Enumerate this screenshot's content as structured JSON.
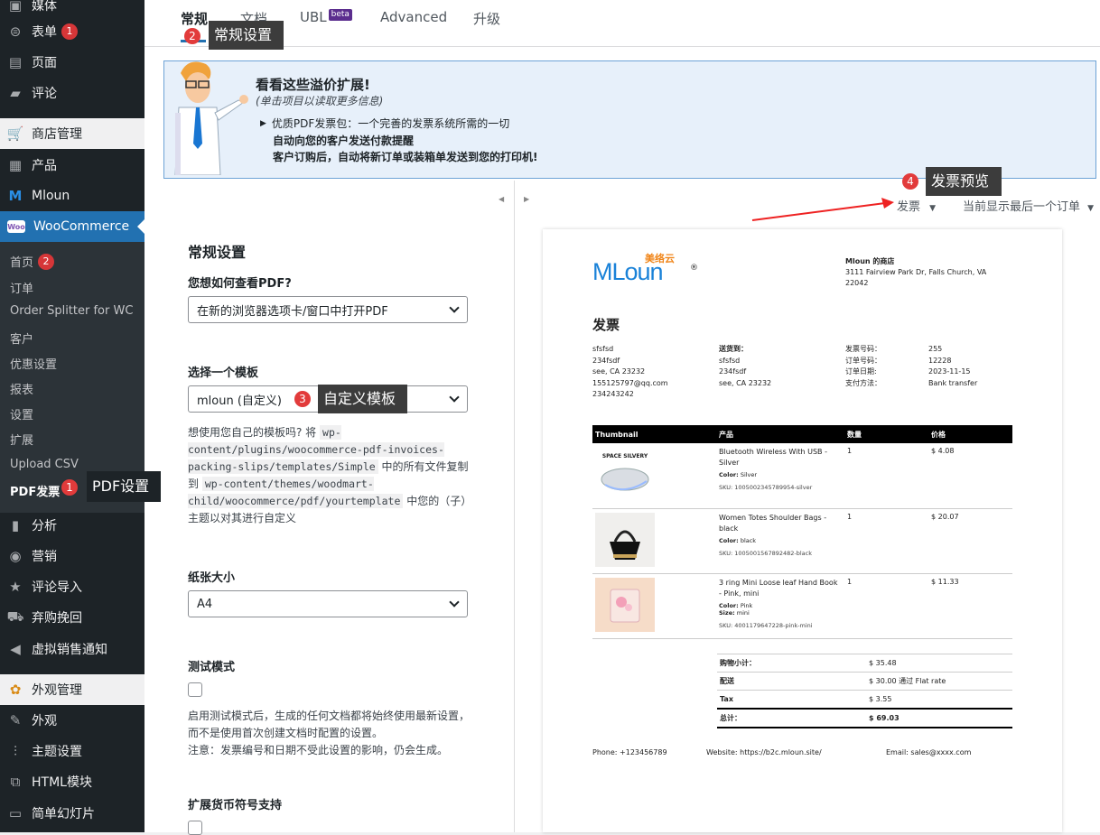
{
  "sidebar": {
    "top_items": [
      {
        "label": "媒体",
        "icon": "media-icon"
      },
      {
        "label": "表单",
        "icon": "forms-icon",
        "badge": "1"
      },
      {
        "label": "页面",
        "icon": "pages-icon"
      },
      {
        "label": "评论",
        "icon": "comments-icon"
      }
    ],
    "shop_header": "商店管理",
    "items2": [
      {
        "label": "产品",
        "icon": "products-icon"
      },
      {
        "label": "Mloun",
        "icon": "mloun-logo-icon"
      }
    ],
    "woo_label": "WooCommerce",
    "submenu": [
      {
        "label": "首页",
        "badge": "2"
      },
      {
        "label": "订单"
      },
      {
        "label": "Order Splitter for WC"
      },
      {
        "label": "客户"
      },
      {
        "label": "优惠设置"
      },
      {
        "label": "报表"
      },
      {
        "label": "设置"
      },
      {
        "label": "扩展"
      },
      {
        "label": "Upload CSV"
      },
      {
        "label": "PDF发票"
      }
    ],
    "items3": [
      {
        "label": "分析",
        "icon": "analytics-icon"
      },
      {
        "label": "营销",
        "icon": "marketing-icon"
      },
      {
        "label": "评论导入",
        "icon": "star-icon"
      },
      {
        "label": "弃购挽回",
        "icon": "cart-icon"
      },
      {
        "label": "虚拟销售通知",
        "icon": "megaphone-icon"
      }
    ],
    "appearance_header": "外观管理",
    "items4": [
      {
        "label": "外观",
        "icon": "brush-icon"
      },
      {
        "label": "主题设置",
        "icon": "sliders-icon"
      },
      {
        "label": "HTML模块",
        "icon": "html-icon"
      },
      {
        "label": "简单幻灯片",
        "icon": "slides-icon"
      }
    ]
  },
  "tabs": [
    {
      "label": "常规",
      "active": true
    },
    {
      "label": "文档"
    },
    {
      "label": "UBL",
      "badge": "beta"
    },
    {
      "label": "Advanced"
    },
    {
      "label": "升级"
    }
  ],
  "callouts": {
    "c1": {
      "num": "1",
      "text": "PDF设置"
    },
    "c2": {
      "num": "2",
      "text": "常规设置"
    },
    "c3": {
      "num": "3",
      "text": "自定义模板"
    },
    "c4": {
      "num": "4",
      "text": "发票预览"
    }
  },
  "banner": {
    "title": "看看这些溢价扩展!",
    "subtitle": "(单击项目以读取更多信息)",
    "item_title": "优质PDF发票包：一个完善的发票系统所需的一切",
    "line2": "自动向您的客户发送付款提醒",
    "line3": "客户订购后，自动将新订单或装箱单发送到您的打印机!"
  },
  "settings": {
    "heading": "常规设置",
    "view_pdf_label": "您想如何查看PDF?",
    "view_pdf_value": "在新的浏览器选项卡/窗口中打开PDF",
    "template_label": "选择一个模板",
    "template_value": "mloun (自定义)",
    "template_desc_1": "想使用您自己的模板吗? 将",
    "template_path_1": "wp-content/plugins/woocommerce-pdf-invoices-packing-slips/templates/Simple",
    "template_desc_2": "中的所有文件复制到",
    "template_path_2": "wp-content/themes/woodmart-child/woocommerce/pdf/yourtemplate",
    "template_desc_3": "中您的（子）主题以对其进行自定义",
    "paper_label": "纸张大小",
    "paper_value": "A4",
    "test_label": "测试模式",
    "test_desc": "启用测试模式后，生成的任何文档都将始终使用最新设置，而不是使用首次创建文档时配置的设置。",
    "test_note": "注意：发票编号和日期不受此设置的影响，仍会生成。",
    "currency_label": "扩展货币符号支持"
  },
  "preview": {
    "doc_type": "发票",
    "order_select": "当前显示最后一个订单"
  },
  "invoice": {
    "logo_text": "MLoun",
    "logo_cn": "美络云",
    "shop_name": "Mloun 的商店",
    "shop_addr1": "3111 Fairview Park Dr, Falls Church, VA",
    "shop_addr2": "22042",
    "title": "发票",
    "bill": [
      "sfsfsd",
      "234fsdf",
      "see, CA 23232",
      "155125797@qq.com",
      "234243242"
    ],
    "ship_label": "送货到：",
    "ship": [
      "sfsfsd",
      "234fsdf",
      "see, CA 23232"
    ],
    "meta": [
      {
        "k": "发票号码：",
        "v": "255"
      },
      {
        "k": "订单号码：",
        "v": "12228"
      },
      {
        "k": "订单日期:",
        "v": "2023-11-15"
      },
      {
        "k": "支付方法：",
        "v": "Bank transfer"
      }
    ],
    "headers": [
      "Thumbnail",
      "产品",
      "数量",
      "价格"
    ],
    "items": [
      {
        "thumb_label": "SPACE SILVERY",
        "name": "Bluetooth Wireless With USB - Silver",
        "color": "Silver",
        "size": "",
        "sku": "SKU: 1005002345789954-silver",
        "qty": "1",
        "price": "$ 4.08"
      },
      {
        "thumb_label": "",
        "name": "Women Totes Shoulder Bags - black",
        "color": "black",
        "size": "",
        "sku": "SKU: 1005001567892482-black",
        "qty": "1",
        "price": "$ 20.07"
      },
      {
        "thumb_label": "",
        "name": "3 ring Mini Loose leaf Hand Book - Pink, mini",
        "color": "Pink",
        "size": "mini",
        "sku": "SKU: 4001179647228-pink-mini",
        "qty": "1",
        "price": "$ 11.33"
      }
    ],
    "color_label": "Color:",
    "size_label": "Size:",
    "totals": [
      {
        "k": "购物小计：",
        "v": "$ 35.48"
      },
      {
        "k": "配送",
        "v": "$ 30.00 通过 Flat rate"
      },
      {
        "k": "Tax",
        "v": "$ 3.55"
      },
      {
        "k": "总计：",
        "v": "$ 69.03"
      }
    ],
    "footer_phone": "Phone: +123456789",
    "footer_web": "Website: https://b2c.mloun.site/",
    "footer_email": "Email: sales@xxxx.com"
  },
  "colors": {
    "sidebar_bg": "#1d2327",
    "accent": "#2271b1",
    "badge": "#d63638",
    "callout": "#3c3c3c",
    "logo_blue": "#1a82d8",
    "logo_orange": "#f08519"
  }
}
